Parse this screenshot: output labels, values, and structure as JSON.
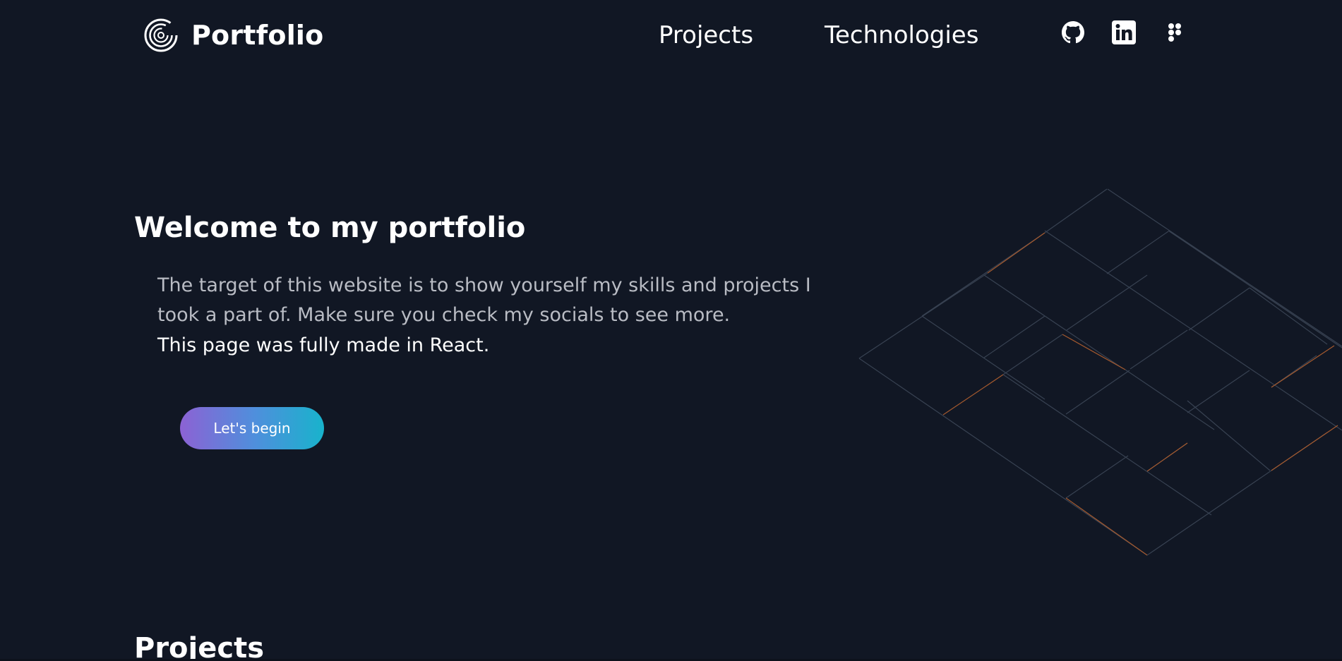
{
  "header": {
    "brand_name": "Portfolio",
    "brand_icon": "spiral-logo-icon",
    "nav": [
      {
        "label": "Projects"
      },
      {
        "label": "Technologies"
      }
    ],
    "socials": [
      {
        "icon": "github-icon"
      },
      {
        "icon": "linkedin-icon"
      },
      {
        "icon": "figma-icon"
      }
    ]
  },
  "hero": {
    "title": "Welcome to my portfolio",
    "description": "The target of this website is to show yourself my skills and projects I took a part of. Make sure you check my socials to see more.",
    "note": "This page was fully made in React.",
    "cta_label": "Let's begin"
  },
  "projects_section": {
    "title": "Projects"
  },
  "colors": {
    "background": "#111724",
    "text_primary": "#ffffff",
    "text_secondary": "#b9bcc4",
    "button_gradient_start": "#8c62d4",
    "button_gradient_end": "#18b3cc",
    "decor_line": "#384252",
    "decor_accent": "#a65a2e"
  }
}
